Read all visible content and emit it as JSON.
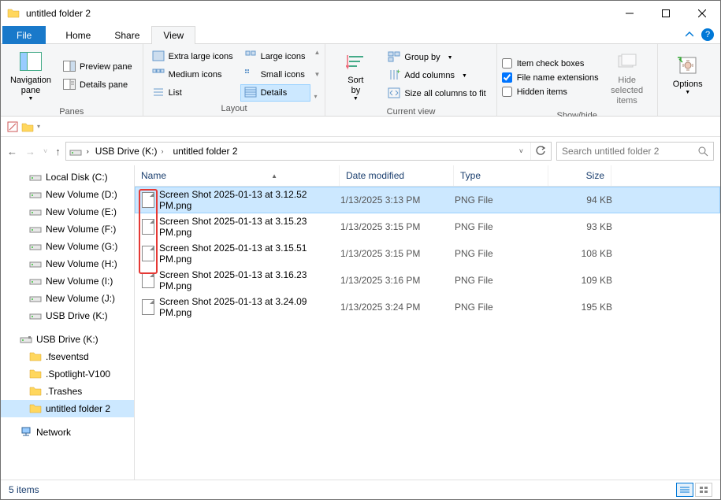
{
  "window": {
    "title": "untitled folder 2"
  },
  "tabs": {
    "file": "File",
    "home": "Home",
    "share": "Share",
    "view": "View"
  },
  "ribbon": {
    "panes": {
      "navigation": "Navigation\npane",
      "preview": "Preview pane",
      "details": "Details pane",
      "group": "Panes"
    },
    "layout": {
      "extra_large": "Extra large icons",
      "large": "Large icons",
      "medium": "Medium icons",
      "small": "Small icons",
      "list": "List",
      "details": "Details",
      "group": "Layout"
    },
    "current_view": {
      "sort_by": "Sort\nby",
      "group_by": "Group by",
      "add_columns": "Add columns",
      "size_all": "Size all columns to fit",
      "group": "Current view"
    },
    "show_hide": {
      "item_check": "Item check boxes",
      "file_ext": "File name extensions",
      "hidden": "Hidden items",
      "hide_selected": "Hide selected\nitems",
      "group": "Show/hide"
    },
    "options": "Options"
  },
  "breadcrumb": {
    "root": "USB Drive (K:)",
    "current": "untitled folder 2"
  },
  "search": {
    "placeholder": "Search untitled folder 2"
  },
  "columns": {
    "name": "Name",
    "date": "Date modified",
    "type": "Type",
    "size": "Size"
  },
  "tree": [
    {
      "label": "Local Disk (C:)",
      "icon": "drive",
      "indent": true
    },
    {
      "label": "New Volume (D:)",
      "icon": "drive",
      "indent": true
    },
    {
      "label": "New Volume (E:)",
      "icon": "drive",
      "indent": true
    },
    {
      "label": "New Volume (F:)",
      "icon": "drive",
      "indent": true
    },
    {
      "label": "New Volume (G:)",
      "icon": "drive",
      "indent": true
    },
    {
      "label": "New Volume (H:)",
      "icon": "drive",
      "indent": true
    },
    {
      "label": "New Volume (I:)",
      "icon": "drive",
      "indent": true
    },
    {
      "label": "New Volume (J:)",
      "icon": "drive",
      "indent": true
    },
    {
      "label": "USB Drive (K:)",
      "icon": "drive",
      "indent": true
    },
    {
      "label": "",
      "spacer": true
    },
    {
      "label": "USB Drive (K:)",
      "icon": "usb",
      "indent": false
    },
    {
      "label": ".fseventsd",
      "icon": "folder",
      "indent": true
    },
    {
      "label": ".Spotlight-V100",
      "icon": "folder",
      "indent": true
    },
    {
      "label": ".Trashes",
      "icon": "folder",
      "indent": true
    },
    {
      "label": "untitled folder 2",
      "icon": "folder",
      "indent": true,
      "selected": true
    },
    {
      "label": "",
      "spacer": true
    },
    {
      "label": "Network",
      "icon": "network",
      "indent": false
    }
  ],
  "files": [
    {
      "name": "Screen Shot 2025-01-13 at 3.12.52 PM.png",
      "date": "1/13/2025 3:13 PM",
      "type": "PNG File",
      "size": "94 KB",
      "selected": true
    },
    {
      "name": "Screen Shot 2025-01-13 at 3.15.23 PM.png",
      "date": "1/13/2025 3:15 PM",
      "type": "PNG File",
      "size": "93 KB"
    },
    {
      "name": "Screen Shot 2025-01-13 at 3.15.51 PM.png",
      "date": "1/13/2025 3:15 PM",
      "type": "PNG File",
      "size": "108 KB"
    },
    {
      "name": "Screen Shot 2025-01-13 at 3.16.23 PM.png",
      "date": "1/13/2025 3:16 PM",
      "type": "PNG File",
      "size": "109 KB"
    },
    {
      "name": "Screen Shot 2025-01-13 at 3.24.09 PM.png",
      "date": "1/13/2025 3:24 PM",
      "type": "PNG File",
      "size": "195 KB"
    }
  ],
  "status": {
    "count": "5 items"
  },
  "checkboxes": {
    "file_ext_checked": true
  }
}
